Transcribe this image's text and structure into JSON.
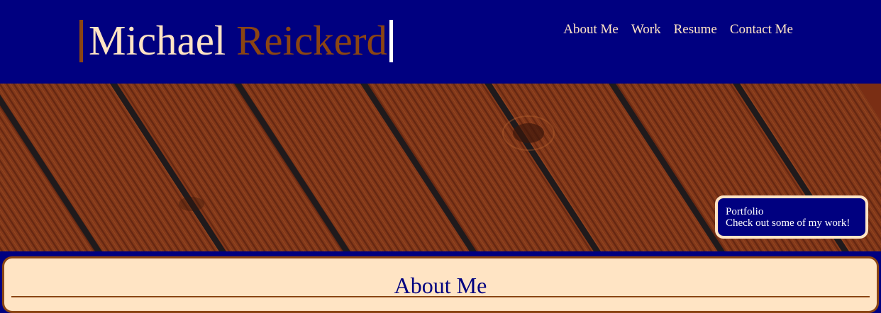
{
  "header": {
    "name_first": "Michael",
    "name_last": "Reickerd"
  },
  "nav": {
    "items": [
      {
        "label": "About Me"
      },
      {
        "label": "Work"
      },
      {
        "label": "Resume"
      },
      {
        "label": "Contact Me"
      }
    ]
  },
  "portfolio_card": {
    "title": "Portfolio",
    "subtitle": "Check out some of my work!"
  },
  "about": {
    "title": "About Me"
  },
  "colors": {
    "navy": "#000080",
    "bisque": "#ffe4c4",
    "brown": "#8b4513",
    "wood": "#8a3a18"
  }
}
